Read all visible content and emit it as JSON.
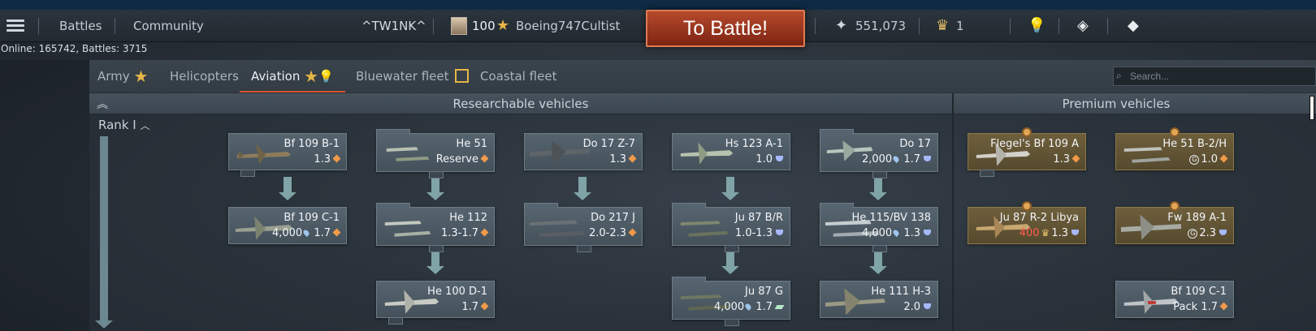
{
  "topbar": {
    "menu_icon": "hamburger-icon",
    "battles": "Battles",
    "community": "Community",
    "squadron_tag": "^TW1NK^",
    "level": "100",
    "username": "Boeing747Cultist",
    "to_battle": "To Battle!",
    "silver_lions": "551,073",
    "golden_eagles": "1"
  },
  "online": "Online: 165742, Battles: 3715",
  "tabs": [
    {
      "label": "Army"
    },
    {
      "label": "Helicopters"
    },
    {
      "label": "Aviation"
    },
    {
      "label": "Bluewater fleet"
    },
    {
      "label": "Coastal fleet"
    }
  ],
  "search": {
    "placeholder": "Search..."
  },
  "headers": {
    "researchable": "Researchable vehicles",
    "premium": "Premium vehicles"
  },
  "rank": "Rank I",
  "vehicles": [
    {
      "name": "Bf 109 B-1",
      "br": "1.3"
    },
    {
      "name": "Bf 109 C-1",
      "cost": "4,000",
      "br": "1.7"
    },
    {
      "name": "He 51",
      "br": "Reserve"
    },
    {
      "name": "He 112",
      "br": "1.3-1.7"
    },
    {
      "name": "He 100 D-1",
      "br": "1.7"
    },
    {
      "name": "Do 17 Z-7",
      "br": "1.3"
    },
    {
      "name": "Do 217 J",
      "br": "2.0-2.3"
    },
    {
      "name": "Hs 123 A-1",
      "br": "1.0"
    },
    {
      "name": "Ju 87 B/R",
      "br": "1.0-1.3"
    },
    {
      "name": "Ju 87 G",
      "cost": "4,000",
      "br": "1.7"
    },
    {
      "name": "Do 17",
      "cost": "2,000",
      "br": "1.7"
    },
    {
      "name": "He 115/BV 138",
      "cost": "4,000",
      "br": "1.3"
    },
    {
      "name": "He 111 H-3",
      "br": "2.0"
    }
  ],
  "premium": [
    {
      "name": "Flegel's Bf 109 A",
      "br": "1.3"
    },
    {
      "name": "He 51 B-2/H",
      "br": "1.0"
    },
    {
      "name": "Ju 87 R-2 Libya",
      "cost": "400",
      "br": "1.3"
    },
    {
      "name": "Fw 189 A-1",
      "br": "2.3"
    },
    {
      "name": "Bf 109 C-1",
      "pack": "Pack",
      "br": "1.7"
    }
  ],
  "colors": {
    "accent": "#d1582d",
    "battle_button": "#9a3620",
    "premium_card": "#6e5f3c"
  }
}
